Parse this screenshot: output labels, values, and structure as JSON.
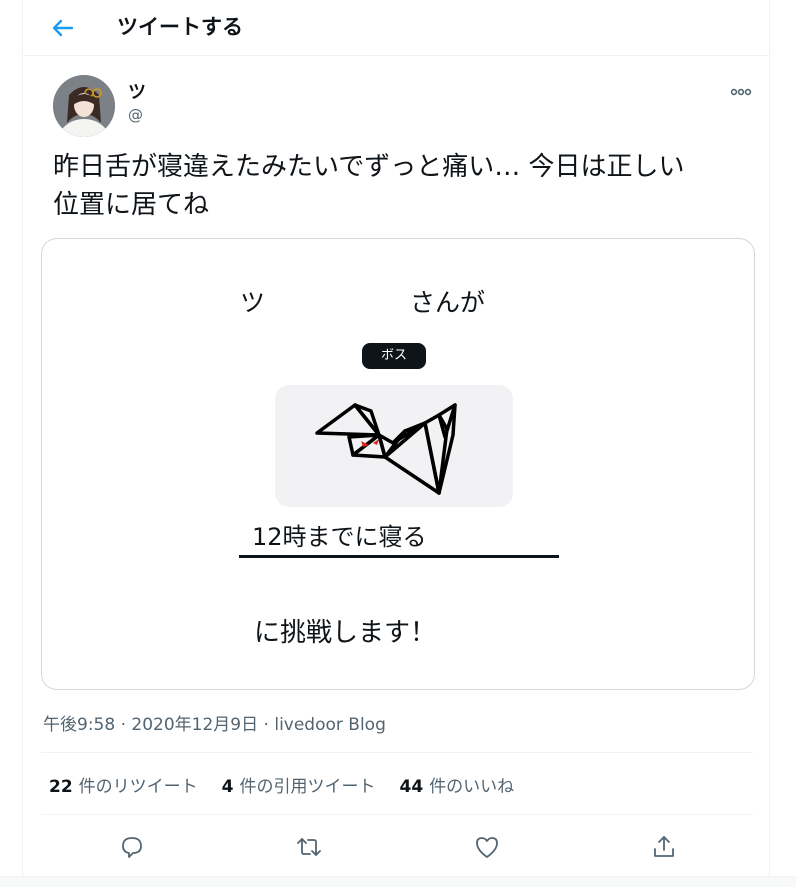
{
  "header": {
    "title": "ツイートする"
  },
  "author": {
    "name": "ツ",
    "handle": "@"
  },
  "tweet": {
    "text_line1": "昨日舌が寝違えたみたいでずっと痛い… 今日は正しい",
    "text_line2": "位置に居てね"
  },
  "card": {
    "name_prefix": "ツ",
    "name_suffix": "さんが",
    "badge": "ボス",
    "goal": "12時までに寝る",
    "challenge": "に挑戦します！"
  },
  "meta": {
    "time": "午後9:58",
    "date": "2020年12月9日",
    "source": "livedoor Blog",
    "separator": "·"
  },
  "stats": [
    {
      "count": "22",
      "label": "件のリツイート"
    },
    {
      "count": "4",
      "label": "件の引用ツイート"
    },
    {
      "count": "44",
      "label": "件のいいね"
    }
  ],
  "icons": {
    "back": "arrow-left-icon",
    "more": "more-horizontal-icon",
    "reply": "reply-icon",
    "retweet": "retweet-icon",
    "like": "heart-icon",
    "share": "share-icon"
  },
  "colors": {
    "accent": "#1d9bf0",
    "text": "#0f1419",
    "secondary": "#536471",
    "eye": "#e0231c"
  }
}
